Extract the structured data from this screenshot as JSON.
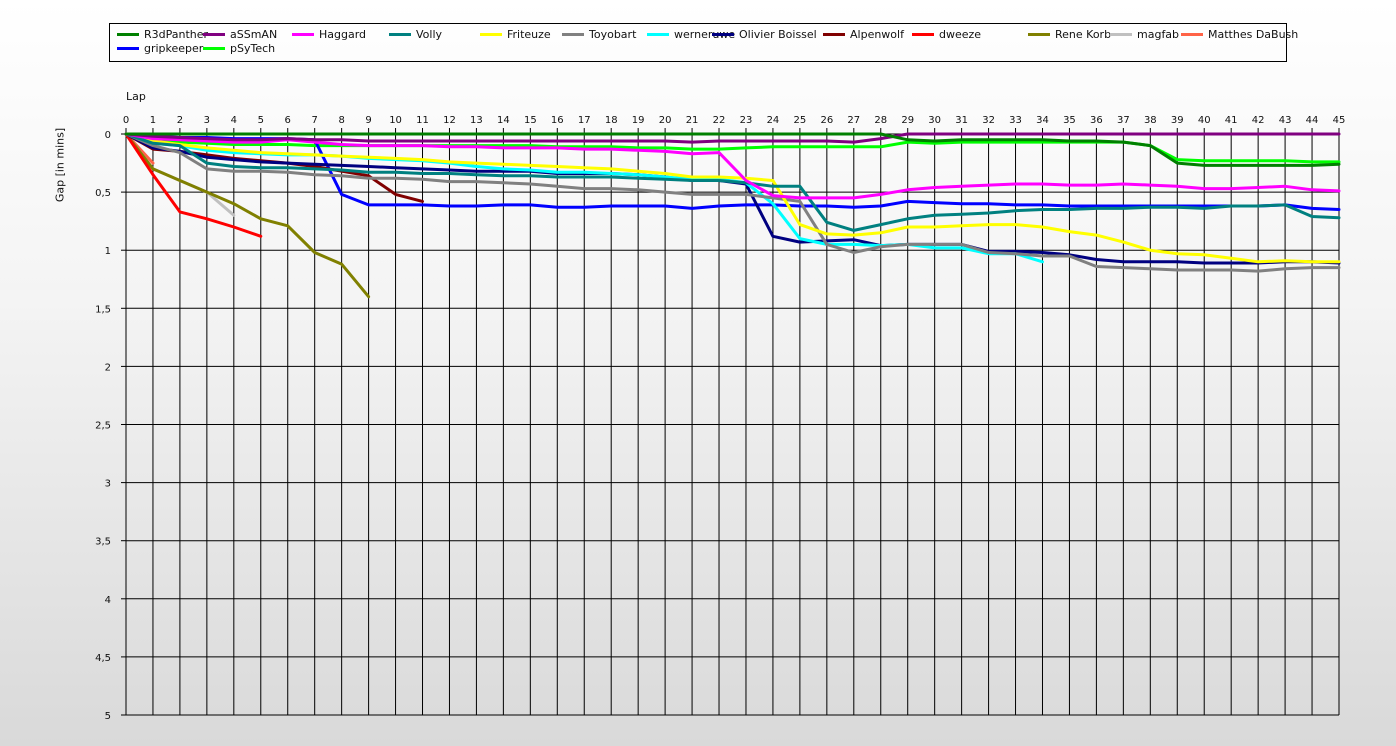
{
  "chart_data": {
    "type": "line",
    "xlabel": "Lap",
    "ylabel": "Gap [in mins]",
    "x": [
      0,
      1,
      2,
      3,
      4,
      5,
      6,
      7,
      8,
      9,
      10,
      11,
      12,
      13,
      14,
      15,
      16,
      17,
      18,
      19,
      20,
      21,
      22,
      23,
      24,
      25,
      26,
      27,
      28,
      29,
      30,
      31,
      32,
      33,
      34,
      35,
      36,
      37,
      38,
      39,
      40,
      41,
      42,
      43,
      44,
      45
    ],
    "x_ticks": [
      "0",
      "1",
      "2",
      "3",
      "4",
      "5",
      "6",
      "7",
      "8",
      "9",
      "10",
      "11",
      "12",
      "13",
      "14",
      "15",
      "16",
      "17",
      "18",
      "19",
      "20",
      "21",
      "22",
      "23",
      "24",
      "25",
      "26",
      "27",
      "28",
      "29",
      "30",
      "31",
      "32",
      "33",
      "34",
      "35",
      "36",
      "37",
      "38",
      "39",
      "40",
      "41",
      "42",
      "43",
      "44",
      "45"
    ],
    "y_ticks": [
      "0",
      "0,5",
      "1",
      "1,5",
      "2",
      "2,5",
      "3",
      "3,5",
      "4",
      "4,5",
      "5"
    ],
    "ylim": [
      0,
      5
    ],
    "y_inverted": true,
    "grid": true,
    "legend_placement": "top",
    "series": [
      {
        "name": "R3dPanther",
        "color": "#008000",
        "values": [
          0,
          0,
          0,
          0,
          0,
          0,
          0,
          0,
          0,
          0,
          0,
          0,
          0,
          0,
          0,
          0,
          0,
          0,
          0,
          0,
          0,
          0,
          0,
          0,
          0,
          0,
          0,
          0,
          0,
          0.05,
          0.06,
          0.05,
          0.05,
          0.05,
          0.05,
          0.06,
          0.06,
          0.07,
          0.1,
          0.25,
          0.27,
          0.27,
          0.27,
          0.27,
          0.27,
          0.26
        ]
      },
      {
        "name": "aSSmAN",
        "color": "#800080",
        "values": [
          0,
          0.02,
          0.03,
          0.04,
          0.05,
          0.05,
          0.04,
          0.05,
          0.05,
          0.06,
          0.06,
          0.06,
          0.06,
          0.06,
          0.06,
          0.06,
          0.06,
          0.06,
          0.06,
          0.06,
          0.06,
          0.07,
          0.06,
          0.06,
          0.06,
          0.06,
          0.06,
          0.07,
          0.04,
          0,
          0,
          0,
          0,
          0,
          0,
          0,
          0,
          0,
          0,
          0,
          0,
          0,
          0,
          0,
          0,
          0
        ]
      },
      {
        "name": "Haggard",
        "color": "#ff00ff",
        "values": [
          0,
          0.04,
          0.05,
          0.06,
          0.07,
          0.07,
          0.05,
          0.07,
          0.09,
          0.1,
          0.1,
          0.1,
          0.11,
          0.11,
          0.12,
          0.12,
          0.12,
          0.13,
          0.13,
          0.14,
          0.15,
          0.17,
          0.16,
          0.4,
          0.53,
          0.55,
          0.55,
          0.55,
          0.52,
          0.48,
          0.46,
          0.45,
          0.44,
          0.43,
          0.43,
          0.44,
          0.44,
          0.43,
          0.44,
          0.45,
          0.47,
          0.47,
          0.46,
          0.45,
          0.48,
          0.49
        ]
      },
      {
        "name": "Volly",
        "color": "#008080",
        "values": [
          0,
          0.08,
          0.1,
          0.25,
          0.28,
          0.29,
          0.29,
          0.3,
          0.31,
          0.33,
          0.33,
          0.34,
          0.34,
          0.35,
          0.36,
          0.36,
          0.37,
          0.37,
          0.37,
          0.38,
          0.39,
          0.4,
          0.4,
          0.42,
          0.45,
          0.45,
          0.76,
          0.83,
          0.78,
          0.73,
          0.7,
          0.69,
          0.68,
          0.66,
          0.65,
          0.65,
          0.64,
          0.64,
          0.63,
          0.63,
          0.64,
          0.62,
          0.62,
          0.61,
          0.71,
          0.72
        ]
      },
      {
        "name": "Friteuze",
        "color": "#ffff00",
        "values": [
          0,
          0.06,
          0.09,
          0.12,
          0.14,
          0.16,
          0.17,
          0.18,
          0.19,
          0.2,
          0.21,
          0.22,
          0.24,
          0.25,
          0.26,
          0.27,
          0.28,
          0.29,
          0.3,
          0.32,
          0.34,
          0.37,
          0.37,
          0.38,
          0.4,
          0.78,
          0.86,
          0.87,
          0.85,
          0.8,
          0.8,
          0.79,
          0.78,
          0.78,
          0.8,
          0.84,
          0.87,
          0.93,
          1.0,
          1.03,
          1.04,
          1.07,
          1.1,
          1.09,
          1.1,
          1.1
        ]
      },
      {
        "name": "Toyobart",
        "color": "#808080",
        "values": [
          0,
          0.1,
          0.16,
          0.3,
          0.32,
          0.32,
          0.33,
          0.35,
          0.36,
          0.38,
          0.38,
          0.39,
          0.41,
          0.41,
          0.42,
          0.43,
          0.45,
          0.47,
          0.47,
          0.48,
          0.5,
          0.52,
          0.52,
          0.52,
          0.55,
          0.58,
          0.95,
          1.02,
          0.97,
          0.95,
          0.95,
          0.95,
          1.02,
          1.03,
          1.05,
          1.05,
          1.14,
          1.15,
          1.16,
          1.17,
          1.17,
          1.17,
          1.18,
          1.16,
          1.15,
          1.15
        ]
      },
      {
        "name": "werneruwe",
        "color": "#00ffff",
        "values": [
          0,
          0.08,
          0.1,
          0.14,
          0.16,
          0.17,
          0.18,
          0.18,
          0.19,
          0.21,
          0.22,
          0.23,
          0.25,
          0.28,
          0.3,
          0.31,
          0.33,
          0.33,
          0.34,
          0.35,
          0.37,
          0.39,
          0.39,
          0.42,
          0.6,
          0.9,
          0.95,
          0.95,
          0.96,
          0.95,
          0.98,
          0.98,
          1.03,
          1.03,
          1.1,
          null,
          null,
          null,
          null,
          null,
          null,
          null,
          null,
          null,
          null,
          null
        ]
      },
      {
        "name": "Olivier Boissel",
        "color": "#000080",
        "values": [
          0,
          0.12,
          0.15,
          0.2,
          0.22,
          0.24,
          0.25,
          0.26,
          0.27,
          0.28,
          0.29,
          0.3,
          0.31,
          0.32,
          0.32,
          0.32,
          0.34,
          0.34,
          0.34,
          0.35,
          0.37,
          0.4,
          0.4,
          0.43,
          0.88,
          0.93,
          0.92,
          0.91,
          0.96,
          0.95,
          0.95,
          0.95,
          1.01,
          1.01,
          1.02,
          1.04,
          1.08,
          1.1,
          1.1,
          1.1,
          1.11,
          1.11,
          1.11,
          1.1,
          1.1,
          1.11
        ]
      },
      {
        "name": "Alpenwolf",
        "color": "#800000",
        "values": [
          0,
          0.13,
          0.15,
          0.18,
          0.21,
          0.23,
          0.25,
          0.28,
          0.32,
          0.36,
          0.52,
          0.58,
          null,
          null,
          null,
          null,
          null,
          null,
          null,
          null,
          null,
          null,
          null,
          null,
          null,
          null,
          null,
          null,
          null,
          null,
          null,
          null,
          null,
          null,
          null,
          null,
          null,
          null,
          null,
          null,
          null,
          null,
          null,
          null,
          null,
          null
        ]
      },
      {
        "name": "dweeze",
        "color": "#ff0000",
        "values": [
          0,
          0.35,
          0.67,
          0.73,
          0.8,
          0.88,
          null,
          null,
          null,
          null,
          null,
          null,
          null,
          null,
          null,
          null,
          null,
          null,
          null,
          null,
          null,
          null,
          null,
          null,
          null,
          null,
          null,
          null,
          null,
          null,
          null,
          null,
          null,
          null,
          null,
          null,
          null,
          null,
          null,
          null,
          null,
          null,
          null,
          null,
          null,
          null
        ]
      },
      {
        "name": "Rene Korb",
        "color": "#808000",
        "values": [
          0,
          0.3,
          0.4,
          0.5,
          0.6,
          0.73,
          0.79,
          1.02,
          1.12,
          1.4,
          null,
          null,
          null,
          null,
          null,
          null,
          null,
          null,
          null,
          null,
          null,
          null,
          null,
          null,
          null,
          null,
          null,
          null,
          null,
          null,
          null,
          null,
          null,
          null,
          null,
          null,
          null,
          null,
          null,
          null,
          null,
          null,
          null,
          null,
          null,
          null
        ]
      },
      {
        "name": "magfab",
        "color": "#c0c0c0",
        "values": [
          0,
          0.3,
          0.4,
          0.5,
          0.7,
          null,
          null,
          null,
          null,
          null,
          null,
          null,
          null,
          null,
          null,
          null,
          null,
          null,
          null,
          null,
          null,
          null,
          null,
          null,
          null,
          null,
          null,
          null,
          null,
          null,
          null,
          null,
          null,
          null,
          null,
          null,
          null,
          null,
          null,
          null,
          null,
          null,
          null,
          null,
          null,
          null
        ]
      },
      {
        "name": "Matthes DaBush",
        "color": "#ff6347",
        "values": [
          0,
          0.25,
          null,
          null,
          null,
          null,
          null,
          null,
          null,
          null,
          null,
          null,
          null,
          null,
          null,
          null,
          null,
          null,
          null,
          null,
          null,
          null,
          null,
          null,
          null,
          null,
          null,
          null,
          null,
          null,
          null,
          null,
          null,
          null,
          null,
          null,
          null,
          null,
          null,
          null,
          null,
          null,
          null,
          null,
          null,
          null
        ]
      },
      {
        "name": "gripkeeper",
        "color": "#0000ff",
        "values": [
          0,
          0.02,
          0.03,
          0.03,
          0.04,
          0.04,
          0.04,
          0.05,
          0.52,
          0.61,
          0.61,
          0.61,
          0.62,
          0.62,
          0.61,
          0.61,
          0.63,
          0.63,
          0.62,
          0.62,
          0.62,
          0.64,
          0.62,
          0.61,
          0.61,
          0.62,
          0.62,
          0.63,
          0.62,
          0.58,
          0.59,
          0.6,
          0.6,
          0.61,
          0.61,
          0.62,
          0.62,
          0.62,
          0.62,
          0.62,
          0.62,
          0.62,
          0.62,
          0.61,
          0.64,
          0.65
        ]
      },
      {
        "name": "pSyTech",
        "color": "#00ff00",
        "values": [
          0,
          0.06,
          0.07,
          0.08,
          0.09,
          0.09,
          0.09,
          0.1,
          0.1,
          0.1,
          0.1,
          0.1,
          0.1,
          0.1,
          0.1,
          0.1,
          0.11,
          0.11,
          0.11,
          0.12,
          0.12,
          0.13,
          0.13,
          0.12,
          0.11,
          0.11,
          0.11,
          0.11,
          0.11,
          0.07,
          0.08,
          0.07,
          0.07,
          0.07,
          0.07,
          0.07,
          0.07,
          0.07,
          0.1,
          0.22,
          0.23,
          0.23,
          0.23,
          0.23,
          0.24,
          0.24
        ]
      }
    ]
  }
}
